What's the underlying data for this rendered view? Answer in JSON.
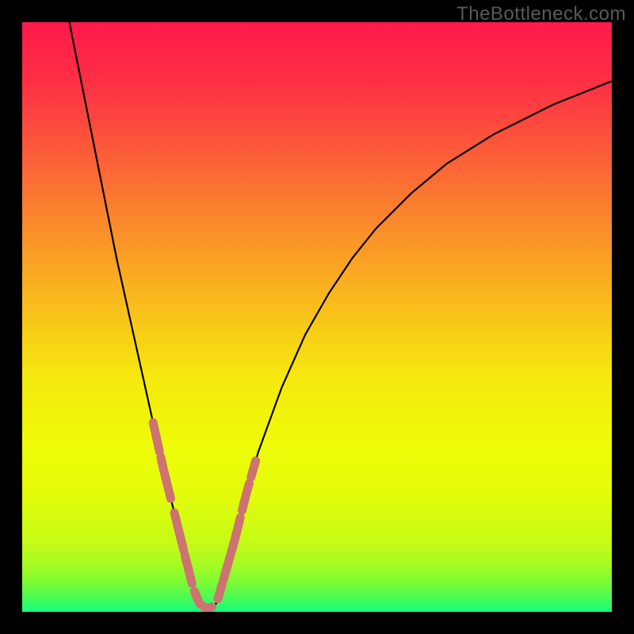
{
  "watermark": "TheBottleneck.com",
  "chart_data": {
    "type": "line",
    "title": "",
    "xlabel": "",
    "ylabel": "",
    "xlim": [
      0,
      100
    ],
    "ylim": [
      0,
      100
    ],
    "description": "Bottleneck V-curve overlaid on a vertical red→yellow→green gradient. The curve descends steeply from top-left, reaches 0 near x≈30, then rises with diminishing slope toward the upper-right. Salmon-colored marker segments are clustered on both legs near the trough.",
    "series": [
      {
        "name": "bottleneck-curve",
        "x": [
          8,
          10,
          12,
          14,
          16,
          18,
          20,
          22,
          24,
          25,
          26,
          27,
          28,
          29,
          30,
          31,
          32,
          33,
          34,
          36,
          38,
          40,
          44,
          48,
          52,
          56,
          60,
          66,
          72,
          80,
          90,
          100
        ],
        "values": [
          100,
          90,
          80,
          70,
          60,
          51,
          42,
          33,
          24,
          20,
          16,
          12,
          8,
          4,
          1.5,
          0.7,
          0.7,
          1.5,
          5,
          12,
          20,
          27,
          38,
          47,
          54,
          60,
          65,
          71,
          76,
          81,
          86,
          90
        ]
      }
    ],
    "markers": {
      "name": "highlight-segments",
      "color": "#cd7371",
      "segments_x_ranges": [
        [
          22.2,
          23.3
        ],
        [
          23.5,
          25.2
        ],
        [
          25.8,
          27.4
        ],
        [
          27.6,
          28.8
        ],
        [
          29.2,
          32.2
        ],
        [
          33.2,
          33.9
        ],
        [
          34.1,
          35.4
        ],
        [
          35.5,
          37.0
        ],
        [
          37.3,
          38.5
        ],
        [
          38.8,
          39.6
        ]
      ]
    },
    "gradient_stops": [
      {
        "pos": 0.0,
        "color": "#fe1a4a"
      },
      {
        "pos": 0.1,
        "color": "#fe2f45"
      },
      {
        "pos": 0.22,
        "color": "#fb5b39"
      },
      {
        "pos": 0.35,
        "color": "#fa8d2a"
      },
      {
        "pos": 0.48,
        "color": "#f9bd1c"
      },
      {
        "pos": 0.6,
        "color": "#f6e80e"
      },
      {
        "pos": 0.72,
        "color": "#eefc07"
      },
      {
        "pos": 0.8,
        "color": "#e3fc0a"
      },
      {
        "pos": 0.88,
        "color": "#c7fb15"
      },
      {
        "pos": 0.92,
        "color": "#a6fb23"
      },
      {
        "pos": 0.95,
        "color": "#7cfb36"
      },
      {
        "pos": 0.975,
        "color": "#4bfb52"
      },
      {
        "pos": 1.0,
        "color": "#16fe84"
      }
    ]
  }
}
